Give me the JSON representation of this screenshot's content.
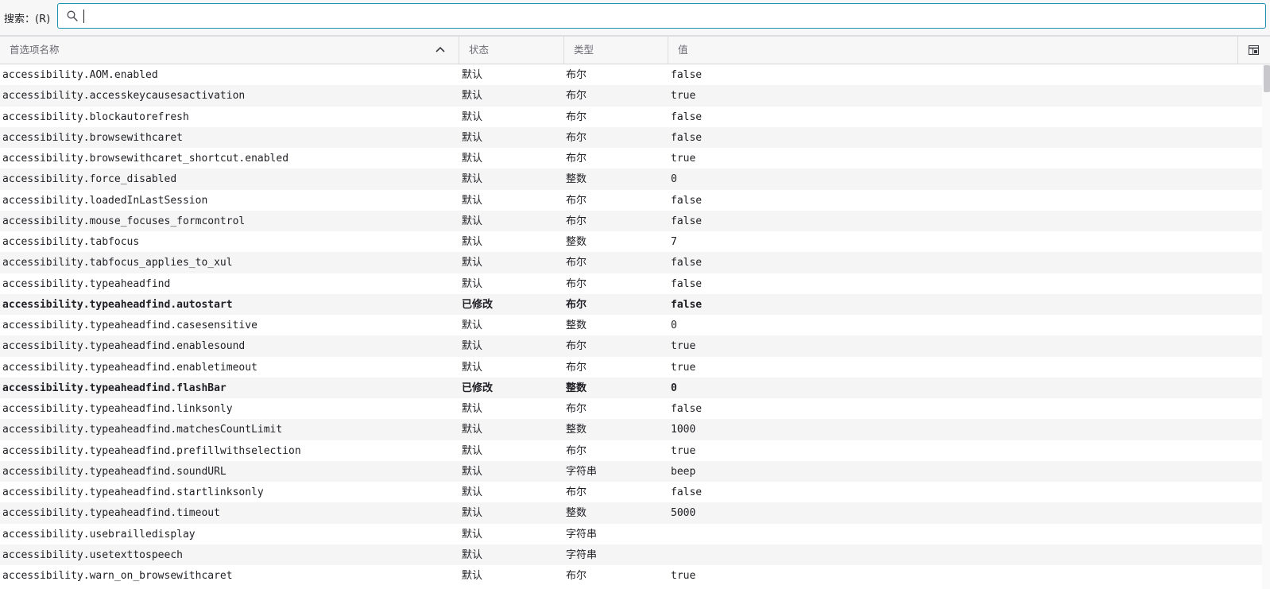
{
  "search": {
    "label": "搜索：(R)",
    "placeholder": "",
    "value": ""
  },
  "columns": {
    "name": "首选项名称",
    "status": "状态",
    "type": "类型",
    "value": "值"
  },
  "icons": {
    "search": "search-icon",
    "sort": "chevron-up-icon",
    "column_picker": "column-picker-icon"
  },
  "colors": {
    "accent": "#1a8fb0",
    "row_alt": "#f5f5f6",
    "header_bg": "#f7f7f7"
  },
  "rows": [
    {
      "name": "accessibility.AOM.enabled",
      "status": "默认",
      "type": "布尔",
      "value": "false",
      "modified": false
    },
    {
      "name": "accessibility.accesskeycausesactivation",
      "status": "默认",
      "type": "布尔",
      "value": "true",
      "modified": false
    },
    {
      "name": "accessibility.blockautorefresh",
      "status": "默认",
      "type": "布尔",
      "value": "false",
      "modified": false
    },
    {
      "name": "accessibility.browsewithcaret",
      "status": "默认",
      "type": "布尔",
      "value": "false",
      "modified": false
    },
    {
      "name": "accessibility.browsewithcaret_shortcut.enabled",
      "status": "默认",
      "type": "布尔",
      "value": "true",
      "modified": false
    },
    {
      "name": "accessibility.force_disabled",
      "status": "默认",
      "type": "整数",
      "value": "0",
      "modified": false
    },
    {
      "name": "accessibility.loadedInLastSession",
      "status": "默认",
      "type": "布尔",
      "value": "false",
      "modified": false
    },
    {
      "name": "accessibility.mouse_focuses_formcontrol",
      "status": "默认",
      "type": "布尔",
      "value": "false",
      "modified": false
    },
    {
      "name": "accessibility.tabfocus",
      "status": "默认",
      "type": "整数",
      "value": "7",
      "modified": false
    },
    {
      "name": "accessibility.tabfocus_applies_to_xul",
      "status": "默认",
      "type": "布尔",
      "value": "false",
      "modified": false
    },
    {
      "name": "accessibility.typeaheadfind",
      "status": "默认",
      "type": "布尔",
      "value": "false",
      "modified": false
    },
    {
      "name": "accessibility.typeaheadfind.autostart",
      "status": "已修改",
      "type": "布尔",
      "value": "false",
      "modified": true
    },
    {
      "name": "accessibility.typeaheadfind.casesensitive",
      "status": "默认",
      "type": "整数",
      "value": "0",
      "modified": false
    },
    {
      "name": "accessibility.typeaheadfind.enablesound",
      "status": "默认",
      "type": "布尔",
      "value": "true",
      "modified": false
    },
    {
      "name": "accessibility.typeaheadfind.enabletimeout",
      "status": "默认",
      "type": "布尔",
      "value": "true",
      "modified": false
    },
    {
      "name": "accessibility.typeaheadfind.flashBar",
      "status": "已修改",
      "type": "整数",
      "value": "0",
      "modified": true
    },
    {
      "name": "accessibility.typeaheadfind.linksonly",
      "status": "默认",
      "type": "布尔",
      "value": "false",
      "modified": false
    },
    {
      "name": "accessibility.typeaheadfind.matchesCountLimit",
      "status": "默认",
      "type": "整数",
      "value": "1000",
      "modified": false
    },
    {
      "name": "accessibility.typeaheadfind.prefillwithselection",
      "status": "默认",
      "type": "布尔",
      "value": "true",
      "modified": false
    },
    {
      "name": "accessibility.typeaheadfind.soundURL",
      "status": "默认",
      "type": "字符串",
      "value": "beep",
      "modified": false
    },
    {
      "name": "accessibility.typeaheadfind.startlinksonly",
      "status": "默认",
      "type": "布尔",
      "value": "false",
      "modified": false
    },
    {
      "name": "accessibility.typeaheadfind.timeout",
      "status": "默认",
      "type": "整数",
      "value": "5000",
      "modified": false
    },
    {
      "name": "accessibility.usebrailledisplay",
      "status": "默认",
      "type": "字符串",
      "value": "",
      "modified": false
    },
    {
      "name": "accessibility.usetexttospeech",
      "status": "默认",
      "type": "字符串",
      "value": "",
      "modified": false
    },
    {
      "name": "accessibility.warn_on_browsewithcaret",
      "status": "默认",
      "type": "布尔",
      "value": "true",
      "modified": false
    }
  ]
}
